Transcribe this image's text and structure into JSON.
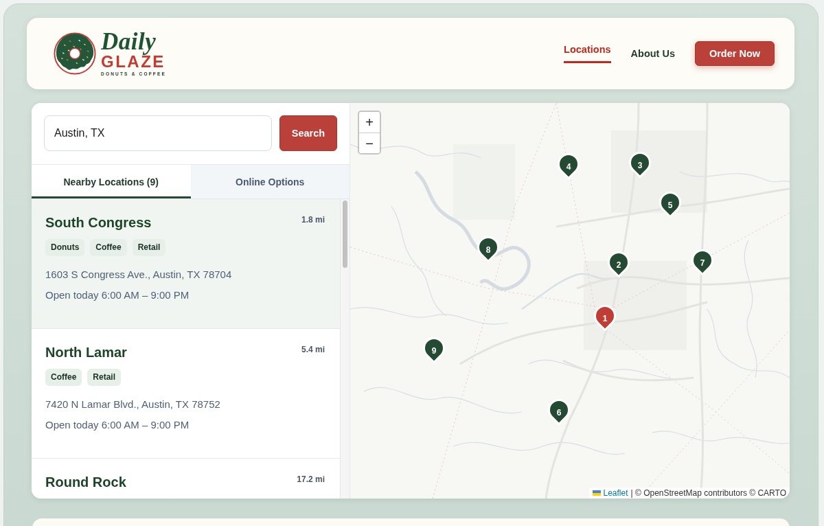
{
  "header": {
    "logo": {
      "script": "Daily",
      "name": "GLAZE",
      "tagline": "DONUTS & COFFEE"
    },
    "nav": [
      {
        "label": "Locations",
        "selected": true
      },
      {
        "label": "About Us",
        "selected": false
      }
    ],
    "cta": "Order Now"
  },
  "search": {
    "value": "Austin, TX",
    "button": "Search"
  },
  "tabs": [
    {
      "label": "Nearby Locations (9)",
      "selected": true
    },
    {
      "label": "Online Options",
      "selected": false
    }
  ],
  "locations": [
    {
      "name": "South Congress",
      "distance": "1.8 mi",
      "tags": [
        "Donuts",
        "Coffee",
        "Retail"
      ],
      "address": "1603 S Congress Ave., Austin, TX 78704",
      "hours": "Open today 6:00 AM – 9:00 PM",
      "selected": true
    },
    {
      "name": "North Lamar",
      "distance": "5.4 mi",
      "tags": [
        "Coffee",
        "Retail"
      ],
      "address": "7420 N Lamar Blvd., Austin, TX 78752",
      "hours": "Open today 6:00 AM – 9:00 PM",
      "selected": false
    },
    {
      "name": "Round Rock",
      "distance": "17.2 mi",
      "selected": false
    }
  ],
  "map": {
    "zoom_controls": [
      "+",
      "−"
    ],
    "markers": [
      {
        "label": "1",
        "selected": true
      },
      {
        "label": "2",
        "selected": false
      },
      {
        "label": "3",
        "selected": false
      },
      {
        "label": "4",
        "selected": false
      },
      {
        "label": "5",
        "selected": false
      },
      {
        "label": "6",
        "selected": false
      },
      {
        "label": "7",
        "selected": false
      },
      {
        "label": "8",
        "selected": false
      },
      {
        "label": "9",
        "selected": false
      }
    ],
    "attribution": {
      "link": "Leaflet",
      "text": "| © OpenStreetMap contributors © CARTO"
    }
  }
}
